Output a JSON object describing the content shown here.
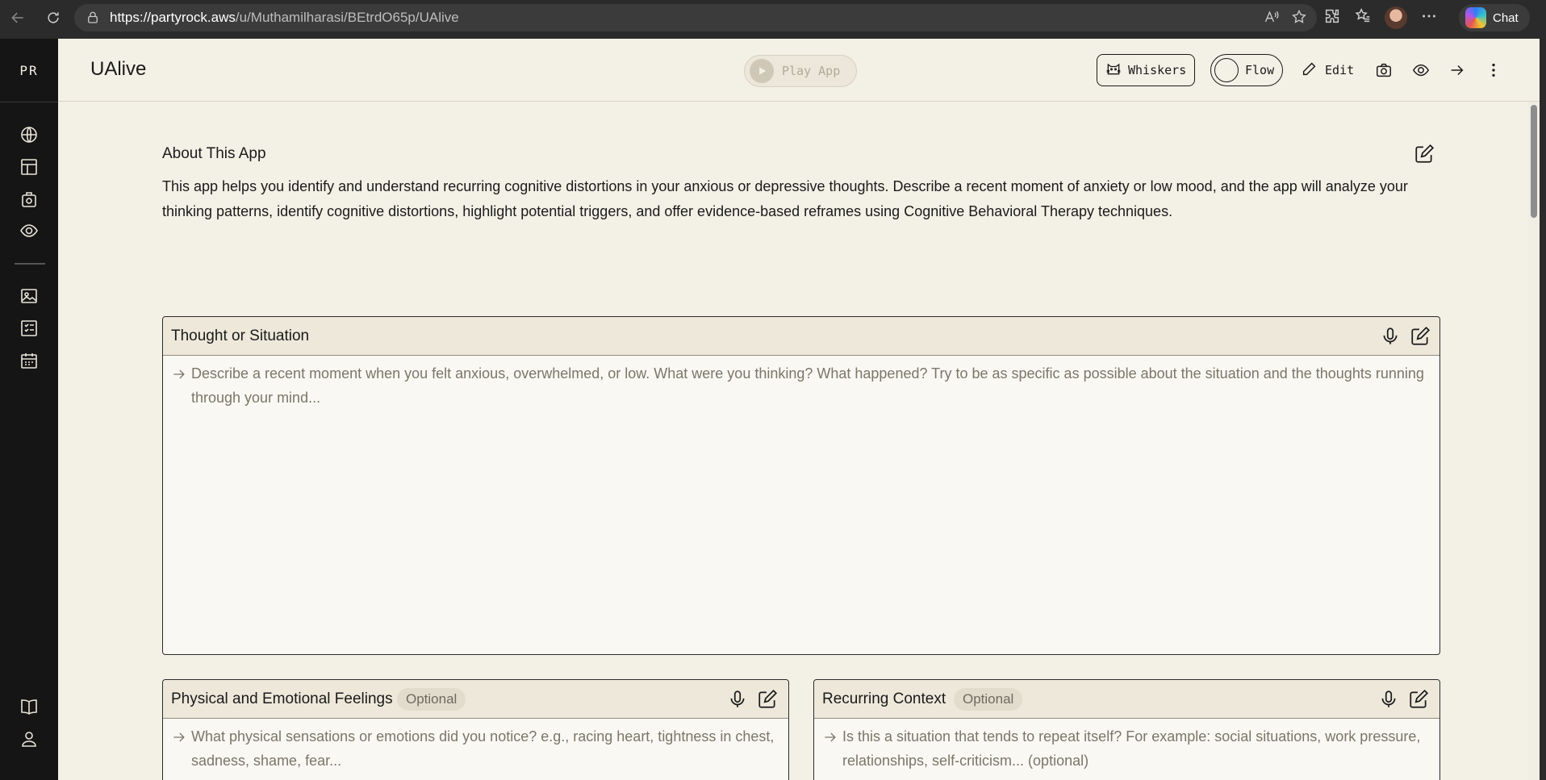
{
  "browser": {
    "url_host": "https://partyrock.aws",
    "url_path": "/u/Muthamilharasi/BEtrdO65p/UAlive",
    "chat_label": "Chat"
  },
  "sidebar": {
    "logo": "PR",
    "items": [
      {
        "icon": "globe-icon"
      },
      {
        "icon": "layout-icon"
      },
      {
        "icon": "backpack-icon"
      },
      {
        "icon": "eye-icon"
      },
      {
        "icon": "image-icon"
      },
      {
        "icon": "checklist-icon"
      },
      {
        "icon": "calendar-icon"
      },
      {
        "icon": "book-icon"
      },
      {
        "icon": "user-icon"
      }
    ]
  },
  "header": {
    "title": "UAlive",
    "play_label": "Play App",
    "whiskers_label": "Whiskers",
    "flow_label": "Flow",
    "edit_label": "Edit"
  },
  "about": {
    "title": "About This App",
    "text": "This app helps you identify and understand recurring cognitive distortions in your anxious or depressive thoughts. Describe a recent moment of anxiety or low mood, and the app will analyze your thinking patterns, identify cognitive distortions, highlight potential triggers, and offer evidence-based reframes using Cognitive Behavioral Therapy techniques."
  },
  "cards": {
    "thought": {
      "title": "Thought or Situation",
      "placeholder": "Describe a recent moment when you felt anxious, overwhelmed, or low. What were you thinking? What happened? Try to be as specific as possible about the situation and the thoughts running through your mind..."
    },
    "feelings": {
      "title": "Physical and Emotional Feelings",
      "badge": "Optional",
      "placeholder": "What physical sensations or emotions did you notice? e.g., racing heart, tightness in chest, sadness, shame, fear..."
    },
    "context": {
      "title": "Recurring Context",
      "badge": "Optional",
      "placeholder": "Is this a situation that tends to repeat itself? For example: social situations, work pressure, relationships, self-criticism... (optional)"
    }
  },
  "colors": {
    "app_bg": "#f3f0e6",
    "sidebar_bg": "#151515",
    "card_head_bg": "#ede8da",
    "text": "#1a1a1a",
    "placeholder": "#7a766a"
  }
}
